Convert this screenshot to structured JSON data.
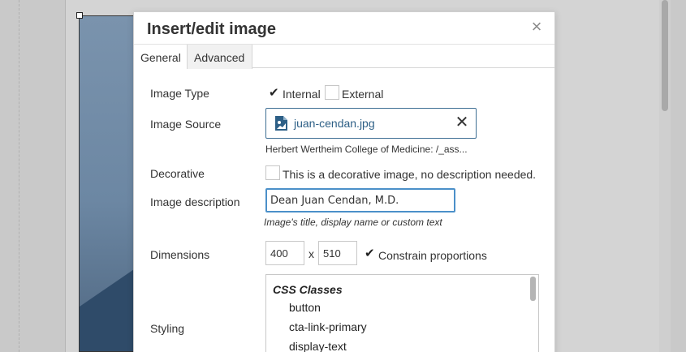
{
  "dialog": {
    "title": "Insert/edit image",
    "close_glyph": "×",
    "tabs": [
      {
        "label": "General",
        "active": true
      },
      {
        "label": "Advanced",
        "active": false
      }
    ]
  },
  "image_type": {
    "label": "Image Type",
    "options": [
      {
        "label": "Internal",
        "checked": true
      },
      {
        "label": "External",
        "checked": false
      }
    ]
  },
  "image_source": {
    "label": "Image Source",
    "file_name": "juan-cendan.jpg",
    "file_icon": "image-file-icon",
    "remove_glyph": "✕",
    "path": "Herbert Wertheim College of Medicine: /_ass..."
  },
  "decorative": {
    "label": "Decorative",
    "checkbox_label": "This is a decorative image, no description needed.",
    "checked": false
  },
  "image_description": {
    "label": "Image description",
    "value": "Dean Juan Cendan, M.D.",
    "hint": "Image's title, display name or custom text"
  },
  "dimensions": {
    "label": "Dimensions",
    "width": "400",
    "height": "510",
    "separator": "x",
    "constrain_label": "Constrain proportions",
    "constrain_checked": true
  },
  "styling": {
    "label": "Styling",
    "group_heading": "CSS Classes",
    "classes": [
      "button",
      "cta-link-primary",
      "display-text"
    ]
  },
  "check_glyph": "✔",
  "colors": {
    "accent": "#2d5f86",
    "focus_border": "#4b90c9"
  }
}
